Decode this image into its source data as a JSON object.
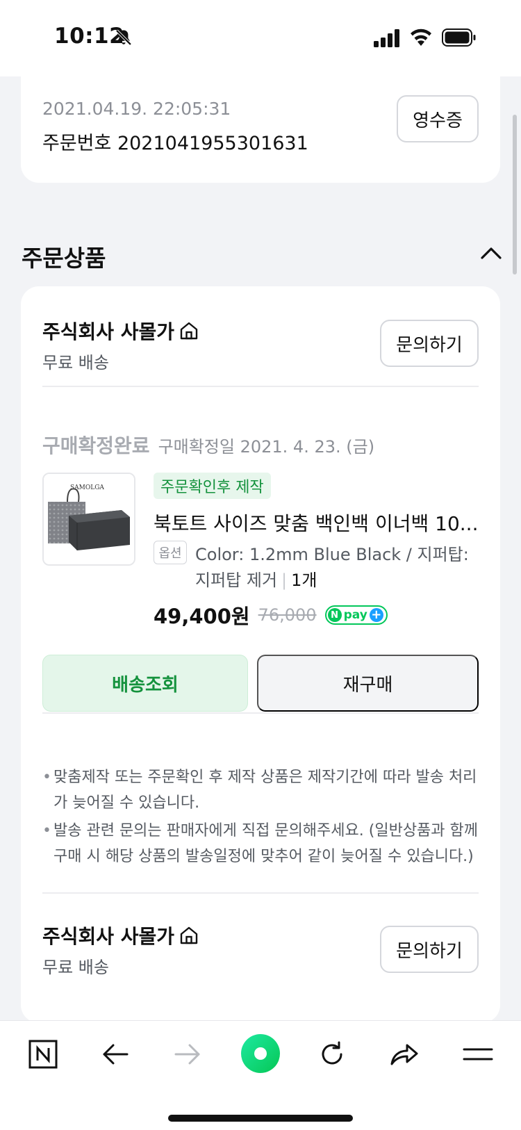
{
  "status_bar": {
    "time": "10:12"
  },
  "order": {
    "datetime": "2021.04.19. 22:05:31",
    "order_number": "주문번호 2021041955301631",
    "receipt_label": "영수증"
  },
  "section": {
    "title": "주문상품"
  },
  "seller": {
    "name": "주식회사 사몰가",
    "shipping": "무료 배송",
    "ask_label": "문의하기"
  },
  "item": {
    "status_label": "구매확정완료",
    "status_date": "구매확정일 2021. 4. 23. (금)",
    "badge": "주문확인후 제작",
    "name": "북토트 사이즈 맞춤 백인백 이너백 10...",
    "option_tag": "옵션",
    "option_text": "Color: 1.2mm Blue Black / 지퍼탑: 지퍼탑 제거",
    "quantity": "1개",
    "price": "49,400원",
    "original_price": "76,000",
    "npay_text": "pay",
    "thumb_brand": "SAMOLGA"
  },
  "actions": {
    "track_label": "배송조회",
    "rebuy_label": "재구매"
  },
  "notes": [
    "맞춤제작 또는 주문확인 후 제작 상품은 제작기간에 따라 발송 처리가 늦어질 수 있습니다.",
    "발송 관련 문의는 판매자에게 직접 문의해주세요. (일반상품과 함께 구매 시 해당 상품의 발송일정에 맞추어 같이 늦어질 수 있습니다.)"
  ],
  "seller2": {
    "name": "주식회사 사몰가",
    "shipping": "무료 배송",
    "ask_label": "문의하기"
  },
  "colors": {
    "accent_green": "#14923d",
    "npay_green": "#03c75a",
    "background": "#f2f3f6"
  }
}
